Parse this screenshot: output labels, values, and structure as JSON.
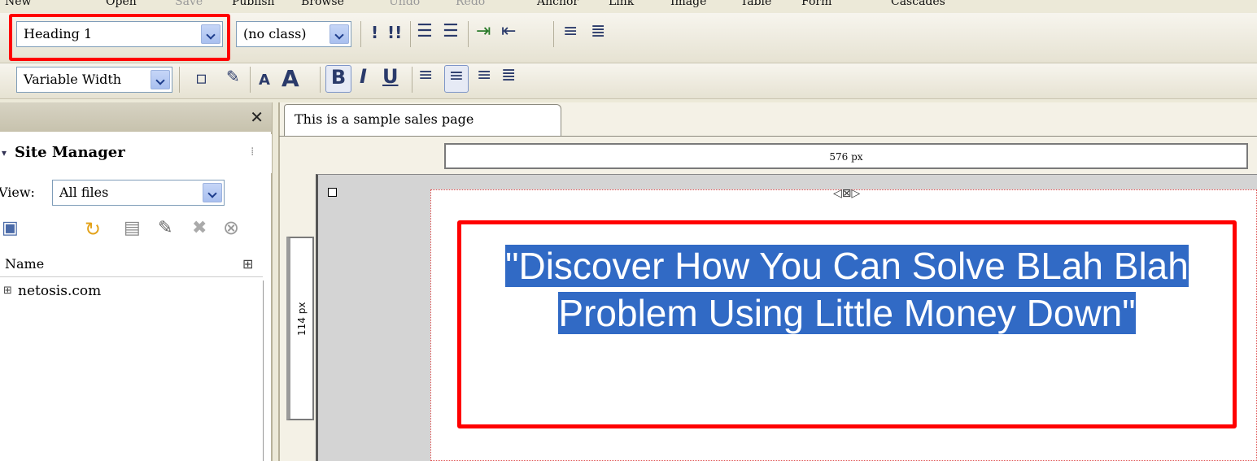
{
  "menu": {
    "items": [
      {
        "label": "New",
        "disabled": false
      },
      {
        "label": "Open",
        "disabled": false
      },
      {
        "label": "Save",
        "disabled": true
      },
      {
        "label": "Publish",
        "disabled": false
      },
      {
        "label": "Browse",
        "disabled": false
      },
      {
        "label": "Undo",
        "disabled": true
      },
      {
        "label": "Redo",
        "disabled": true
      },
      {
        "label": "Anchor",
        "disabled": false
      },
      {
        "label": "Link",
        "disabled": false
      },
      {
        "label": "Image",
        "disabled": false
      },
      {
        "label": "Table",
        "disabled": false
      },
      {
        "label": "Form",
        "disabled": false
      },
      {
        "label": "Cascades",
        "disabled": false
      }
    ]
  },
  "format_toolbar": {
    "paragraph_style": "Heading 1",
    "class_select": "(no class)",
    "font_select": "Variable Width",
    "bold_glyph": "B",
    "italic_glyph": "I",
    "underline_glyph": "U"
  },
  "site_manager": {
    "title": "Site Manager",
    "view_label": "View:",
    "view_value": "All files",
    "column_name": "Name",
    "tree_item": "netosis.com"
  },
  "editor": {
    "tab_title": "This is a sample sales page",
    "width_ruler": "576 px",
    "height_ruler": "114 px",
    "headline": "\"Discover How You Can Solve BLah Blah Problem Using Little Money Down\""
  },
  "colors": {
    "highlight_border": "#ff0000",
    "selection": "#316ac5"
  }
}
